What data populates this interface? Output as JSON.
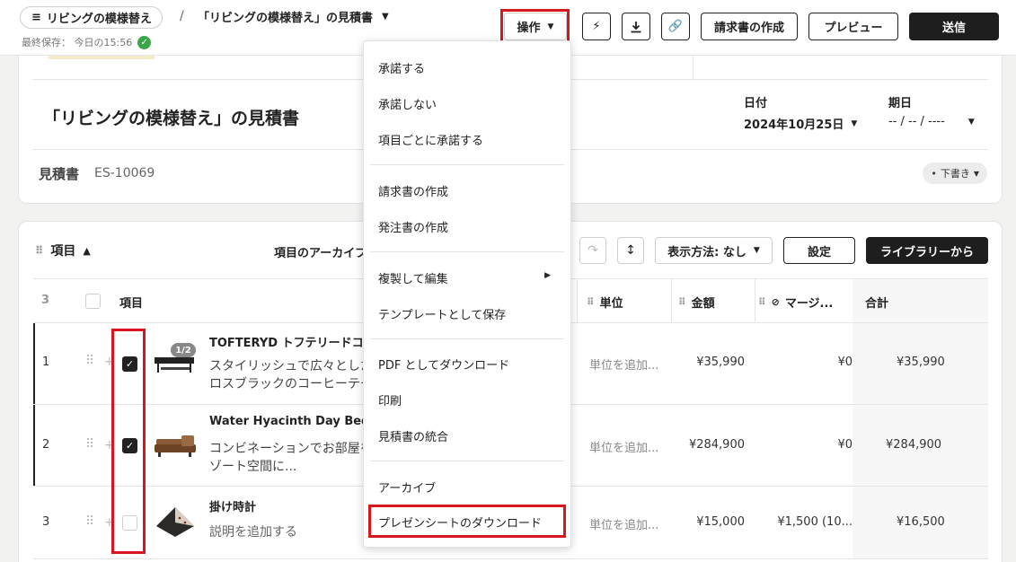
{
  "header": {
    "project_pill": "リビングの模様替え",
    "separator": "/",
    "doc_title": "「リビングの模様替え」の見積書",
    "last_saved": "最終保存： 今日の15:56",
    "ops_button": "操作",
    "invoice_button": "請求書の作成",
    "preview_button": "プレビュー",
    "send_button": "送信"
  },
  "doc": {
    "title": "「リビングの模様替え」の見積書",
    "date_label": "日付",
    "date_value": "2024年10月25日",
    "due_label": "期日",
    "due_value": "-- / -- / ----",
    "estimate_label": "見積書",
    "estimate_number": "ES-10069",
    "status": "下書き"
  },
  "items_section": {
    "title": "項目",
    "archive_label": "項目のアーカイブ",
    "view_select": "表示方法: なし",
    "settings_button": "設定",
    "library_button": "ライブラリーから"
  },
  "table": {
    "count": "3",
    "col_item": "項目",
    "col_unit": "単位",
    "col_amount": "金額",
    "col_margin": "マージ...",
    "col_total": "合計",
    "rows": [
      {
        "num": "1",
        "badge": "1/2",
        "name": "TOFTERYD トフテリードコ",
        "desc1": "スタイリッシュで広々とした",
        "desc2": "ロスブラックのコーヒーテー",
        "unit": "単位を追加...",
        "amount": "¥35,990",
        "margin": "¥0",
        "total": "¥35,990"
      },
      {
        "num": "2",
        "badge": "",
        "name": "Water Hyacinth Day Bed So",
        "desc1": "コンビネーションでお部屋を",
        "desc2": "ゾート空間に...",
        "unit": "単位を追加...",
        "amount": "¥284,900",
        "margin": "¥0",
        "total": "¥284,900"
      },
      {
        "num": "3",
        "badge": "",
        "name": "掛け時計",
        "desc1": "説明を追加する",
        "desc2": "",
        "unit": "単位を追加...",
        "amount": "¥15,000",
        "margin": "¥1,500 (10...",
        "total": "¥16,500"
      }
    ]
  },
  "menu": {
    "items": [
      "承諾する",
      "承諾しない",
      "項目ごとに承諾する",
      "請求書の作成",
      "発注書の作成",
      "複製して編集",
      "テンプレートとして保存",
      "PDF としてダウンロード",
      "印刷",
      "見積書の統合",
      "アーカイブ",
      "プレゼンシートのダウンロード"
    ]
  },
  "colors": {
    "highlight": "#d9161c",
    "primary_dark": "#1e1e1e",
    "success": "#3aa64a"
  }
}
